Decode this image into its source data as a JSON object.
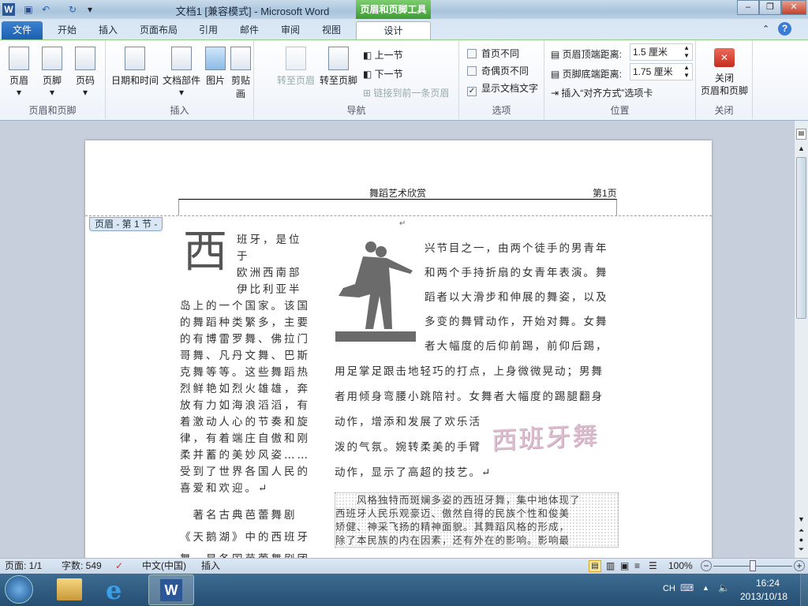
{
  "window": {
    "title": "文档1 [兼容模式] - Microsoft Word",
    "context_tools": "页眉和页脚工具",
    "minimize": "–",
    "restore": "❐",
    "close": "✕"
  },
  "tabs": [
    "文件",
    "开始",
    "插入",
    "页面布局",
    "引用",
    "邮件",
    "审阅",
    "视图",
    "设计"
  ],
  "ribbon": {
    "groups": {
      "header_footer": "页眉和页脚",
      "insert": "插入",
      "navigation": "导航",
      "options": "选项",
      "position": "位置",
      "close": "关闭"
    },
    "header": "页眉",
    "footer": "页脚",
    "page_number": "页码",
    "date_time": "日期和时间",
    "quick_parts": "文档部件",
    "picture": "图片",
    "clip_art": "剪贴画",
    "goto_header": "转至页眉",
    "goto_footer": "转至页脚",
    "prev_section": "上一节",
    "next_section": "下一节",
    "link_previous": "链接到前一条页眉",
    "different_first": "首页不同",
    "different_odd_even": "奇偶页不同",
    "show_document_text": "显示文档文字",
    "different_first_checked": false,
    "different_odd_even_checked": false,
    "show_document_text_checked": true,
    "header_top_label": "页眉顶端距离:",
    "header_top_value": "1.5 厘米",
    "footer_bottom_label": "页脚底端距离:",
    "footer_bottom_value": "1.75 厘米",
    "insert_alignment_tab": "插入“对齐方式”选项卡",
    "close_header_footer": "关闭\n页眉和页脚"
  },
  "document": {
    "header_title": "舞蹈艺术欣赏",
    "header_page": "第1页",
    "header_tag": "页眉 - 第 1 节 -",
    "drop_cap": "西",
    "left_lines": [
      "班牙，是位于",
      "欧洲西南部",
      "伊比利亚半",
      "岛上的一个国家。该国",
      "的舞蹈种类繁多，主要",
      "的有博雷罗舞、佛拉门",
      "哥舞、凡丹文舞、巴斯",
      "克舞等等。这些舞蹈热",
      "烈鲜艳如烈火雄雄，奔",
      "放有力如海浪滔滔，有",
      "着激动人心的节奏和旋",
      "律，有着端庄自傲和刚",
      "柔并蓄的美妙风姿……",
      "受到了世界各国人民的",
      "喜爱和欢迎。↵"
    ],
    "left_para2": [
      "　著名古典芭蕾舞剧",
      "《天鹅湖》中的西班牙",
      "舞，是各国芭蕾舞剧团"
    ],
    "right_lines": [
      "兴节目之一，由两个徒手的男青年",
      "和两个手持折扇的女青年表演。舞",
      "蹈者以大滑步和伸展的舞姿，以及",
      "多变的舞臂动作，开始对舞。女舞",
      "者大幅度的后仰前踢，前仰后踢，"
    ],
    "right_full_lines": [
      "用足掌足跟击地轻巧的打点，上身微微晃动；男舞",
      "者用倾身弯腰小跳陪衬。女舞者大幅度的踢腿翻身",
      "动作，增添和发展了欢乐活",
      "泼的气氛。婉转柔美的手臂",
      "动作，显示了高超的技艺。↵"
    ],
    "wordart": "西班牙舞",
    "dotted_para": [
      "　　风格独特而斑斓多姿的西班牙舞，集中地体现了",
      "西班牙人民乐观豪迈、傲然自得的民族个性和俊美",
      "矫健、神采飞扬的精神面貌。其舞蹈风格的形成，",
      "除了本民族的内在因素，还有外在的影响。影响最"
    ]
  },
  "status": {
    "page": "页面: 1/1",
    "words": "字数: 549",
    "language": "中文(中国)",
    "mode": "插入",
    "zoom": "100%",
    "zoom_level": 100
  },
  "taskbar": {
    "lang": "CH",
    "time": "16:24",
    "date": "2013/10/18"
  }
}
